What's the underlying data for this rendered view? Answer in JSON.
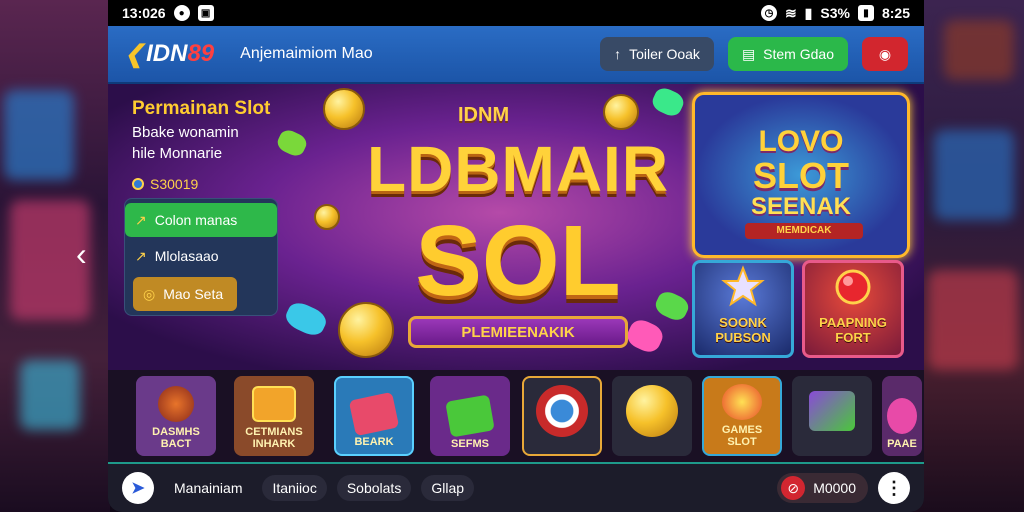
{
  "status_bar": {
    "time_left": "13:026",
    "battery": "S3%",
    "time_right": "8:25"
  },
  "header": {
    "logo_mark": "❮",
    "logo_text": "IDN",
    "logo_num": "89",
    "title": "Anjemaimiom Mao",
    "btn_trailer": "Toiler Ooak",
    "btn_stem": "Stem Gdao"
  },
  "hero": {
    "promo_title": "Permainan Slot",
    "promo_line2": "Bbake wonamin",
    "promo_line3": "hile Monnarie",
    "balance": "S30019",
    "menu": [
      {
        "label": "Colon manas",
        "icon": "↗"
      },
      {
        "label": "Mlolasaao",
        "icon": "↗"
      },
      {
        "label": "Mao Seta",
        "icon": "◎"
      }
    ],
    "banner_brand": "IDNM",
    "banner_word1": "LDBMAIR",
    "banner_word2": "SOL",
    "banner_ribbon": "PLEMIEENAKIK",
    "card_line1": "LOVO",
    "card_line2": "SLOT",
    "card_line3": "SEENAK",
    "card_tag": "MEMDICAK",
    "mini_a": "SOONK\nPUBSON",
    "mini_b": "PAAPNING\nFORT"
  },
  "games": [
    {
      "label": "DASMHS\nBACT",
      "color": "#6a3a8a"
    },
    {
      "label": "CETMIANS\nINHARK",
      "color": "#8a4a2a"
    },
    {
      "label": "BEARK",
      "color": "#2a7ab8"
    },
    {
      "label": "SEFMS",
      "color": "#6a2a8a"
    },
    {
      "label": "",
      "color": "#2a2a3a"
    },
    {
      "label": "",
      "color": "#2a2a3a"
    },
    {
      "label": "GAMES\nSLOT",
      "color": "#c87a1a"
    },
    {
      "label": "",
      "color": "#2a2a3a"
    },
    {
      "label": "PAAE",
      "color": "#5a2a6a"
    }
  ],
  "bottom_bar": {
    "tab1": "Manainiam",
    "tab2": "Itaniioc",
    "tab3": "Sobolats",
    "tab4": "Gllap",
    "amount": "M0000"
  },
  "colors": {
    "topbar": "#2a6cc4",
    "accent_green": "#2bb84a",
    "accent_red": "#d2262e",
    "gold": "#ffd23a"
  }
}
